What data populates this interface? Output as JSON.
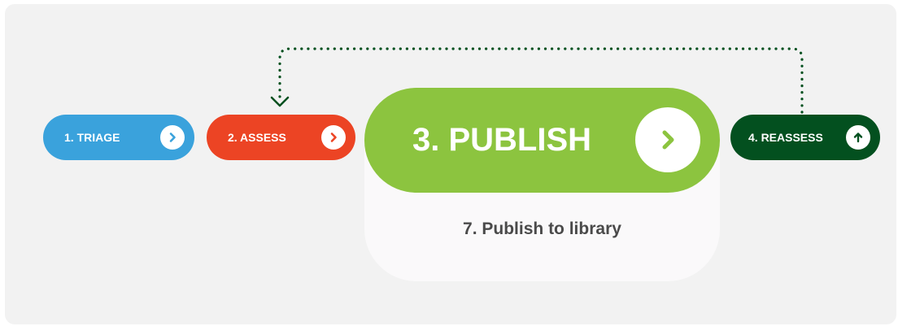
{
  "steps": [
    {
      "label": "1. TRIAGE",
      "color": "#3aa2dc",
      "icon": "chevron-right-icon"
    },
    {
      "label": "2. ASSESS",
      "color": "#ec4424",
      "icon": "chevron-right-icon"
    },
    {
      "label": "3. PUBLISH",
      "color": "#8cc43f",
      "icon": "chevron-right-icon",
      "detail": "7. Publish to library"
    },
    {
      "label": "4. REASSESS",
      "color": "#03501f",
      "icon": "arrow-up-icon"
    }
  ],
  "loop": {
    "from": "4. REASSESS",
    "to": "2. ASSESS",
    "style": "dotted",
    "color": "#03501f"
  },
  "colors": {
    "background": "#f2f2f2",
    "card": "#faf9fa",
    "detail_text": "#4a4a4a"
  }
}
